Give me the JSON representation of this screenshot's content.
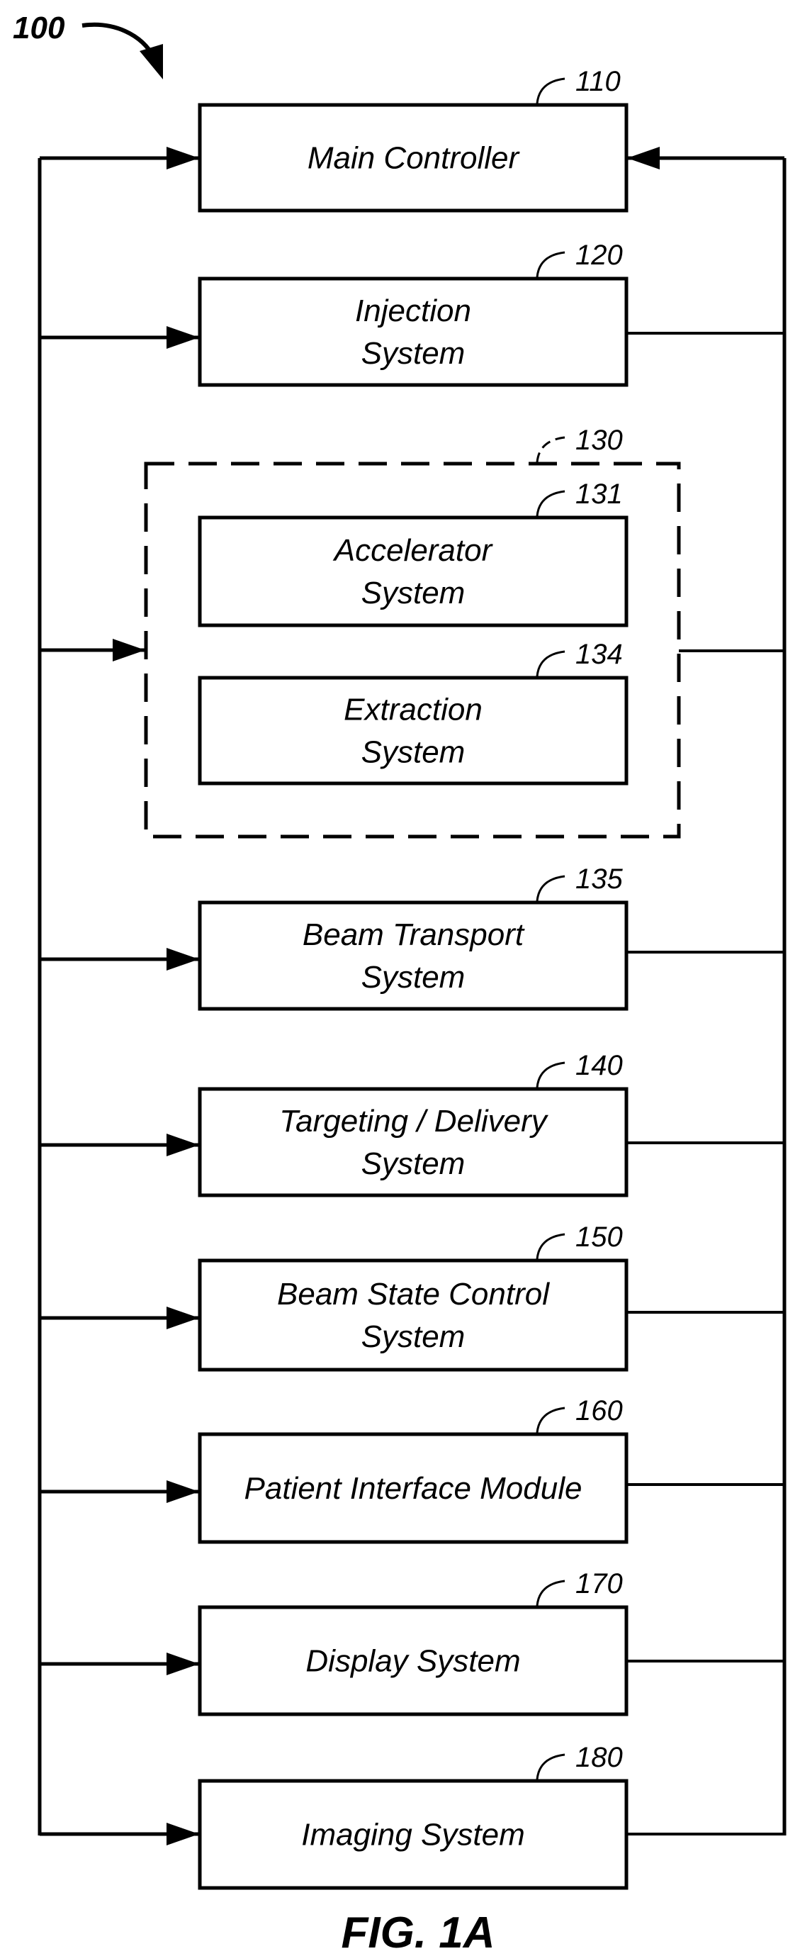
{
  "figure": {
    "label": "FIG. 1A",
    "system_ref": "100"
  },
  "colors": {
    "stroke": "#000000",
    "background": "#ffffff"
  },
  "blocks": [
    {
      "id": "main-controller",
      "ref": "110",
      "lines": [
        "Main Controller"
      ],
      "input_arrow_from_left": true,
      "input_arrow_from_right": true
    },
    {
      "id": "injection-system",
      "ref": "120",
      "lines": [
        "Injection",
        "System"
      ],
      "input_arrow_from_left": true,
      "output_to_right_bus": true
    },
    {
      "id": "accelerator-group",
      "ref": "130",
      "dashed": true,
      "input_arrow_from_left": true,
      "output_to_right_bus": true,
      "children": [
        {
          "id": "accelerator-system",
          "ref": "131",
          "lines": [
            "Accelerator",
            "System"
          ]
        },
        {
          "id": "extraction-system",
          "ref": "134",
          "lines": [
            "Extraction",
            "System"
          ]
        }
      ]
    },
    {
      "id": "beam-transport-system",
      "ref": "135",
      "lines": [
        "Beam Transport",
        "System"
      ],
      "input_arrow_from_left": true,
      "output_to_right_bus": true
    },
    {
      "id": "targeting-delivery-system",
      "ref": "140",
      "lines": [
        "Targeting / Delivery",
        "System"
      ],
      "input_arrow_from_left": true,
      "output_to_right_bus": true
    },
    {
      "id": "beam-state-control-system",
      "ref": "150",
      "lines": [
        "Beam State Control",
        "System"
      ],
      "input_arrow_from_left": true,
      "output_to_right_bus": true
    },
    {
      "id": "patient-interface-module",
      "ref": "160",
      "lines": [
        "Patient Interface Module"
      ],
      "input_arrow_from_left": true,
      "output_to_right_bus": true
    },
    {
      "id": "display-system",
      "ref": "170",
      "lines": [
        "Display System"
      ],
      "input_arrow_from_left": true,
      "output_to_right_bus": true
    },
    {
      "id": "imaging-system",
      "ref": "180",
      "lines": [
        "Imaging System"
      ],
      "input_arrow_from_left": true,
      "output_to_right_bus": true
    }
  ]
}
